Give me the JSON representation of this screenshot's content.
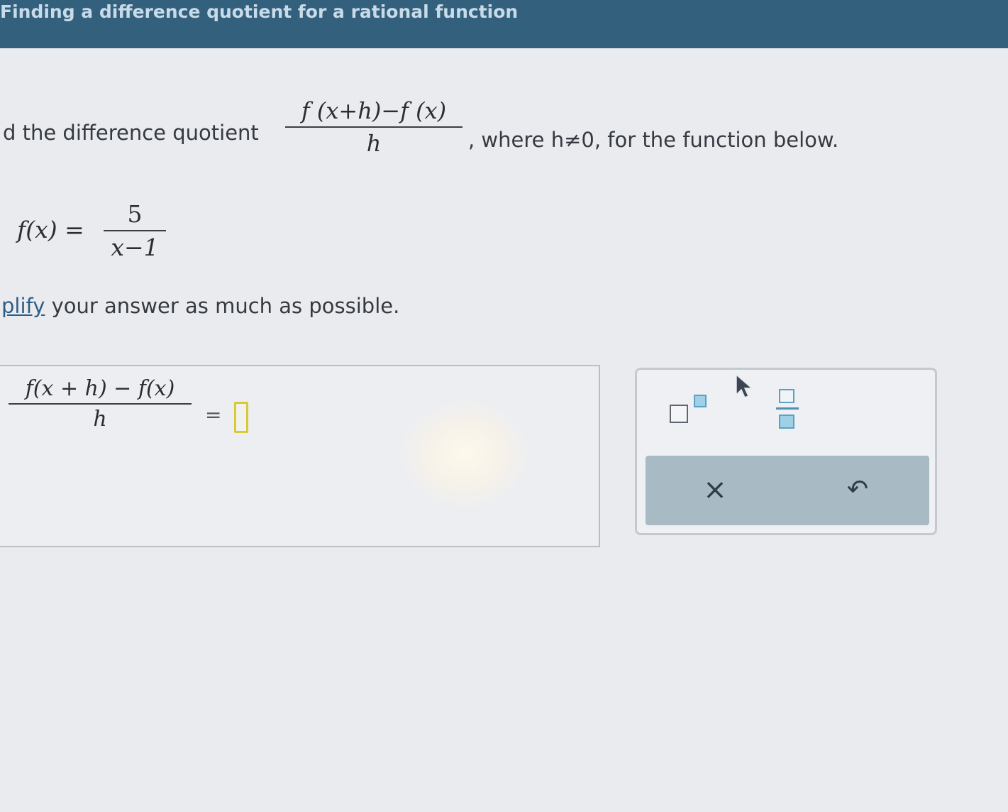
{
  "header": {
    "title": "Finding a difference quotient for a rational function"
  },
  "instruction": {
    "lead_text": "d the difference quotient",
    "quotient_numerator": "f (x+h)−f (x)",
    "quotient_denominator": "h",
    "tail_text": ", where h≠0, for the function below."
  },
  "function": {
    "lhs": "f(x) =",
    "numerator": "5",
    "denominator": "x−1"
  },
  "simplify": {
    "link_text": "plify",
    "rest_text": " your answer as much as possible."
  },
  "answer": {
    "lhs_numerator": "f(x + h) − f(x)",
    "lhs_denominator": "h",
    "equals": "=",
    "input_value": ""
  },
  "palette": {
    "exponent_tool_icon": "superscript-icon",
    "fraction_tool_icon": "fraction-icon",
    "clear_label": "×",
    "undo_label": "↶"
  }
}
